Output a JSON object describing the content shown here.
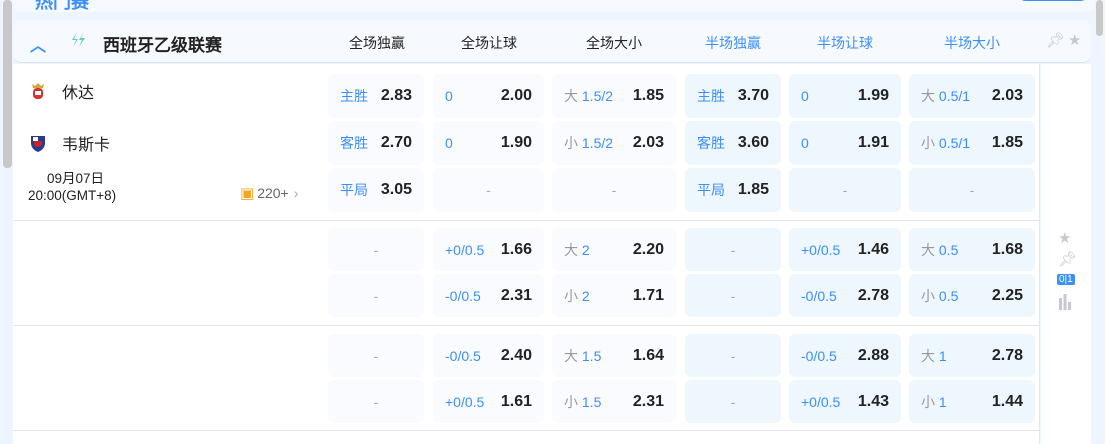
{
  "top": {
    "title": "热门赛"
  },
  "header": {
    "league": "西班牙乙级联赛",
    "accent": "#3b8ff5",
    "columns": [
      {
        "label": "全场独赢",
        "color": "#222222"
      },
      {
        "label": "全场让球",
        "color": "#222222"
      },
      {
        "label": "全场大小",
        "color": "#222222"
      },
      {
        "label": "半场独赢",
        "color": "#3b8ff5"
      },
      {
        "label": "半场让球",
        "color": "#3b8ff5"
      },
      {
        "label": "半场大小",
        "color": "#3b8ff5"
      }
    ]
  },
  "match": {
    "home": "休达",
    "away": "韦斯卡",
    "date": "09月07日",
    "time": "20:00(GMT+8)",
    "more_markets": "220+"
  },
  "groups": [
    {
      "rows": [
        [
          {
            "lab": "主胜",
            "val": "2.83"
          },
          {
            "lab": "0",
            "val": "2.00"
          },
          {
            "pre": "大",
            "lab": "1.5/2",
            "val": "1.85"
          },
          {
            "lab": "主胜",
            "val": "3.70"
          },
          {
            "lab": "0",
            "val": "1.99"
          },
          {
            "pre": "大",
            "lab": "0.5/1",
            "val": "2.03"
          }
        ],
        [
          {
            "lab": "客胜",
            "val": "2.70"
          },
          {
            "lab": "0",
            "val": "1.90"
          },
          {
            "pre": "小",
            "lab": "1.5/2",
            "val": "2.03"
          },
          {
            "lab": "客胜",
            "val": "3.60"
          },
          {
            "lab": "0",
            "val": "1.91"
          },
          {
            "pre": "小",
            "lab": "0.5/1",
            "val": "1.85"
          }
        ],
        [
          {
            "lab": "平局",
            "val": "3.05"
          },
          {
            "dash": "-"
          },
          {
            "dash": "-"
          },
          {
            "lab": "平局",
            "val": "1.85"
          },
          {
            "dash": "-"
          },
          {
            "dash": "-"
          }
        ]
      ]
    },
    {
      "rows": [
        [
          {
            "dash": "-"
          },
          {
            "lab": "+0/0.5",
            "val": "1.66"
          },
          {
            "pre": "大",
            "lab": "2",
            "val": "2.20"
          },
          {
            "dash": "-"
          },
          {
            "lab": "+0/0.5",
            "val": "1.46"
          },
          {
            "pre": "大",
            "lab": "0.5",
            "val": "1.68"
          }
        ],
        [
          {
            "dash": "-"
          },
          {
            "lab": "-0/0.5",
            "val": "2.31"
          },
          {
            "pre": "小",
            "lab": "2",
            "val": "1.71"
          },
          {
            "dash": "-"
          },
          {
            "lab": "-0/0.5",
            "val": "2.78"
          },
          {
            "pre": "小",
            "lab": "0.5",
            "val": "2.25"
          }
        ]
      ]
    },
    {
      "rows": [
        [
          {
            "dash": "-"
          },
          {
            "lab": "-0/0.5",
            "val": "2.40"
          },
          {
            "pre": "大",
            "lab": "1.5",
            "val": "1.64"
          },
          {
            "dash": "-"
          },
          {
            "lab": "-0/0.5",
            "val": "2.88"
          },
          {
            "pre": "大",
            "lab": "1",
            "val": "2.78"
          }
        ],
        [
          {
            "dash": "-"
          },
          {
            "lab": "+0/0.5",
            "val": "1.61"
          },
          {
            "pre": "小",
            "lab": "1.5",
            "val": "2.31"
          },
          {
            "dash": "-"
          },
          {
            "lab": "+0/0.5",
            "val": "1.43"
          },
          {
            "pre": "小",
            "lab": "1",
            "val": "1.44"
          }
        ]
      ]
    }
  ],
  "side_icons": [
    "star-icon",
    "pin-icon",
    "score-icon",
    "stats-icon"
  ],
  "side_score_label": "0|1"
}
